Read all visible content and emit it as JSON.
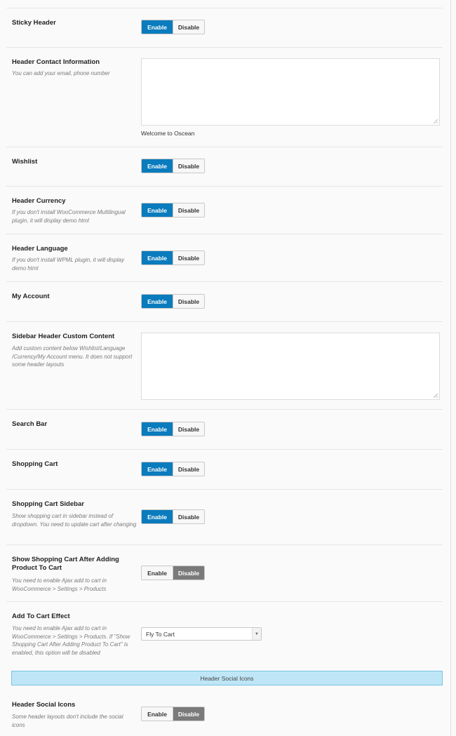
{
  "toggle_labels": {
    "enable": "Enable",
    "disable": "Disable"
  },
  "sticky_header": {
    "title": "Sticky Header",
    "state": "enable"
  },
  "header_contact": {
    "title": "Header Contact Information",
    "desc": "You can add your email, phone number",
    "value": "",
    "help": "Welcome to Oscean"
  },
  "wishlist": {
    "title": "Wishlist",
    "state": "enable"
  },
  "header_currency": {
    "title": "Header Currency",
    "desc": "If you don't install WooCommerce Multilingual plugin, it will display demo html",
    "state": "enable"
  },
  "header_language": {
    "title": "Header Language",
    "desc": "If you don't install WPML plugin, it will display demo html",
    "state": "enable"
  },
  "my_account": {
    "title": "My Account",
    "state": "enable"
  },
  "sidebar_custom": {
    "title": "Sidebar Header Custom Content",
    "desc": "Add custom content below Wishlist/Language /Currency/My Account menu. It does not support some header layouts",
    "value": ""
  },
  "search_bar": {
    "title": "Search Bar",
    "state": "enable"
  },
  "shopping_cart": {
    "title": "Shopping Cart",
    "state": "enable"
  },
  "cart_sidebar": {
    "title": "Shopping Cart Sidebar",
    "desc": "Show shopping cart in sidebar instead of dropdown. You need to update cart after changing",
    "state": "enable"
  },
  "show_cart_after_add": {
    "title": "Show Shopping Cart After Adding Product To Cart",
    "desc": "You need to enable Ajax add to cart in WooCommerce > Settings > Products",
    "state": "disable"
  },
  "add_to_cart_effect": {
    "title": "Add To Cart Effect",
    "desc": "You need to enable Ajax add to cart in WooCommerce > Settings > Products. If \"Show Shopping Cart After Adding Product To Cart\" is enabled, this option will be disabled",
    "selected": "Fly To Cart"
  },
  "section_social": {
    "label": "Header Social Icons"
  },
  "header_social_icons": {
    "title": "Header Social Icons",
    "desc": "Some header layouts don't include the social icons",
    "state": "disable"
  },
  "colors": {
    "enable_active": "#0a7bbd",
    "disable_active": "#7a7a7a",
    "section_bar": "#bfe6f6"
  }
}
